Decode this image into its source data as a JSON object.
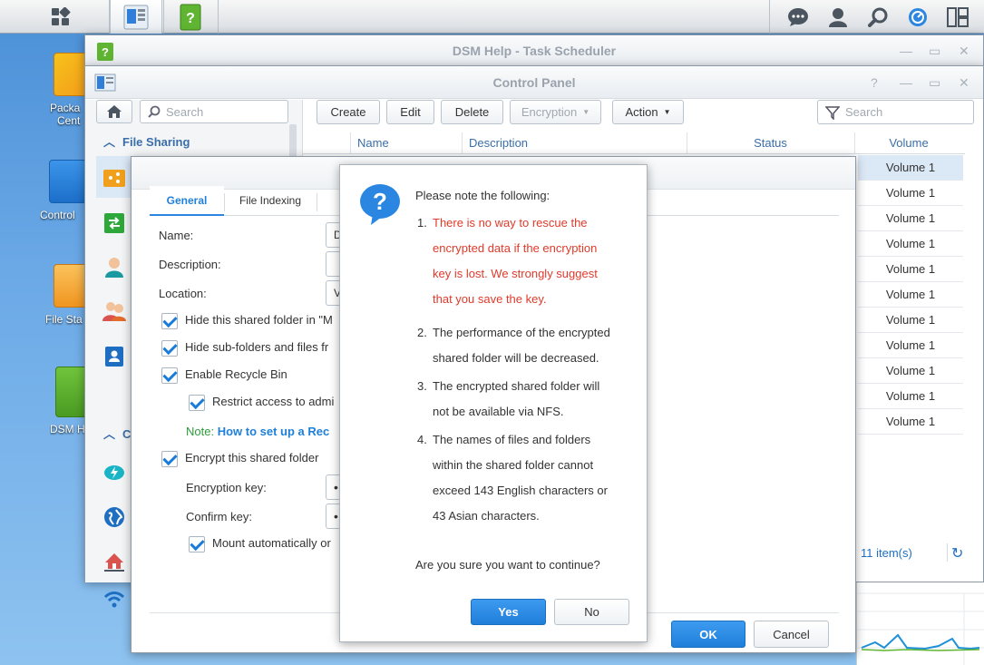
{
  "taskbar": {
    "apps": [
      "main-menu",
      "control-panel",
      "dsm-help"
    ],
    "right_icons": [
      "chat-icon",
      "user-icon",
      "search-icon",
      "notification-icon",
      "widgets-icon"
    ]
  },
  "desktop": {
    "icons": [
      {
        "label": "Package Center",
        "shown": "Packa",
        "shown2": "Cent"
      },
      {
        "label": "Control Panel",
        "shown": "Control"
      },
      {
        "label": "File Station",
        "shown": "File Sta"
      },
      {
        "label": "DSM Help",
        "shown": "DSM H"
      }
    ]
  },
  "help_window": {
    "title": "DSM Help - Task Scheduler"
  },
  "control_panel": {
    "title": "Control Panel",
    "search_placeholder": "Search",
    "section_file_sharing": "File Sharing",
    "section_c": "C",
    "toolbar": {
      "create": "Create",
      "edit": "Edit",
      "delete": "Delete",
      "encryption": "Encryption",
      "action": "Action",
      "filter_placeholder": "Search"
    },
    "columns": [
      "Name",
      "Description",
      "Status",
      "Volume"
    ],
    "rows": [
      "Volume 1",
      "Volume 1",
      "Volume 1",
      "Volume 1",
      "Volume 1",
      "Volume 1",
      "Volume 1",
      "Volume 1",
      "Volume 1",
      "Volume 1",
      "Volume 1"
    ],
    "item_count": "11 item(s)"
  },
  "edit_dialog": {
    "tabs": [
      "General",
      "File Indexing"
    ],
    "name_label": "Name:",
    "name_value": "D",
    "description_label": "Description:",
    "location_label": "Location:",
    "location_value": "V",
    "hide_folder": "Hide this shared folder in \"M",
    "hide_subfolders": "Hide sub-folders and files fr",
    "enable_recycle": "Enable Recycle Bin",
    "restrict_access": "Restrict access to admi",
    "note_label": "Note:",
    "note_link": "How to set up a Rec",
    "encrypt": "Encrypt this shared folder",
    "enc_key_label": "Encryption key:",
    "enc_key_value": "•",
    "confirm_key_label": "Confirm key:",
    "confirm_key_value": "•",
    "mount_auto": "Mount automatically or",
    "ok": "OK",
    "cancel": "Cancel"
  },
  "confirm_dialog": {
    "heading": "Please note the following:",
    "items": [
      {
        "num": "1.",
        "lines": [
          "There is no way to rescue the",
          "encrypted data if the encryption",
          "key is lost. We strongly suggest",
          "that you save the key."
        ]
      },
      {
        "num": "2.",
        "lines": [
          "The performance of the encrypted",
          "shared folder will be decreased."
        ]
      },
      {
        "num": "3.",
        "lines": [
          "The encrypted shared folder will",
          "not be available via NFS."
        ]
      },
      {
        "num": "4.",
        "lines": [
          "The names of files and folders",
          "within the shared folder cannot",
          "exceed 143 English characters or",
          "43 Asian characters."
        ]
      }
    ],
    "question": "Are you sure you want to continue?",
    "yes": "Yes",
    "no": "No"
  },
  "colors": {
    "accent": "#1f7fd9",
    "warning": "#e03a2a",
    "note": "#2e9c3a"
  }
}
